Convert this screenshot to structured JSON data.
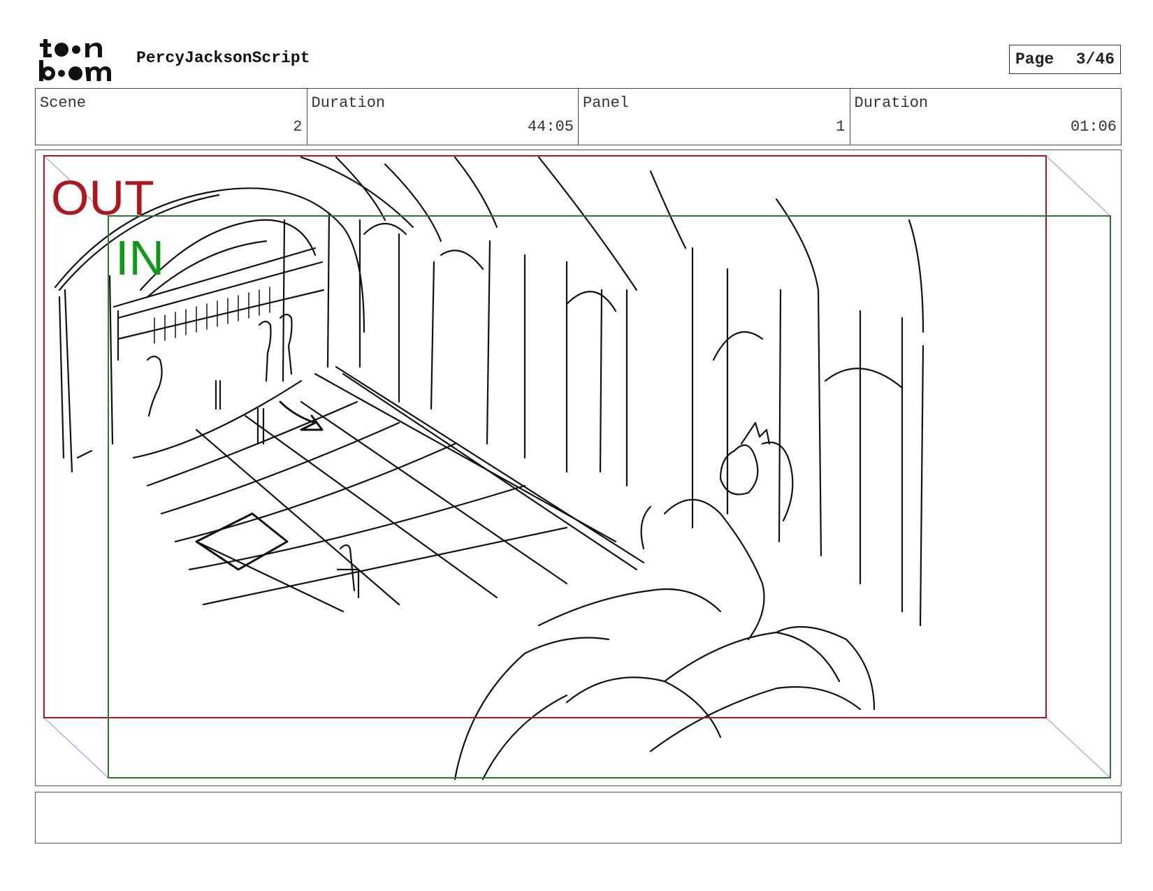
{
  "header": {
    "logo_text": "toon boom",
    "project_title": "PercyJacksonScript",
    "page_label": "Page",
    "page_value": "3/46"
  },
  "info": [
    {
      "label": "Scene",
      "value": "2"
    },
    {
      "label": "Duration",
      "value": "44:05"
    },
    {
      "label": "Panel",
      "value": "1"
    },
    {
      "label": "Duration",
      "value": "01:06"
    }
  ],
  "panel": {
    "out_label": "OUT",
    "in_label": "IN",
    "out_color": "#b0141c",
    "in_color": "#0e9a18",
    "in_frame_color": "#2c7a2c"
  },
  "caption": {
    "text": ""
  }
}
